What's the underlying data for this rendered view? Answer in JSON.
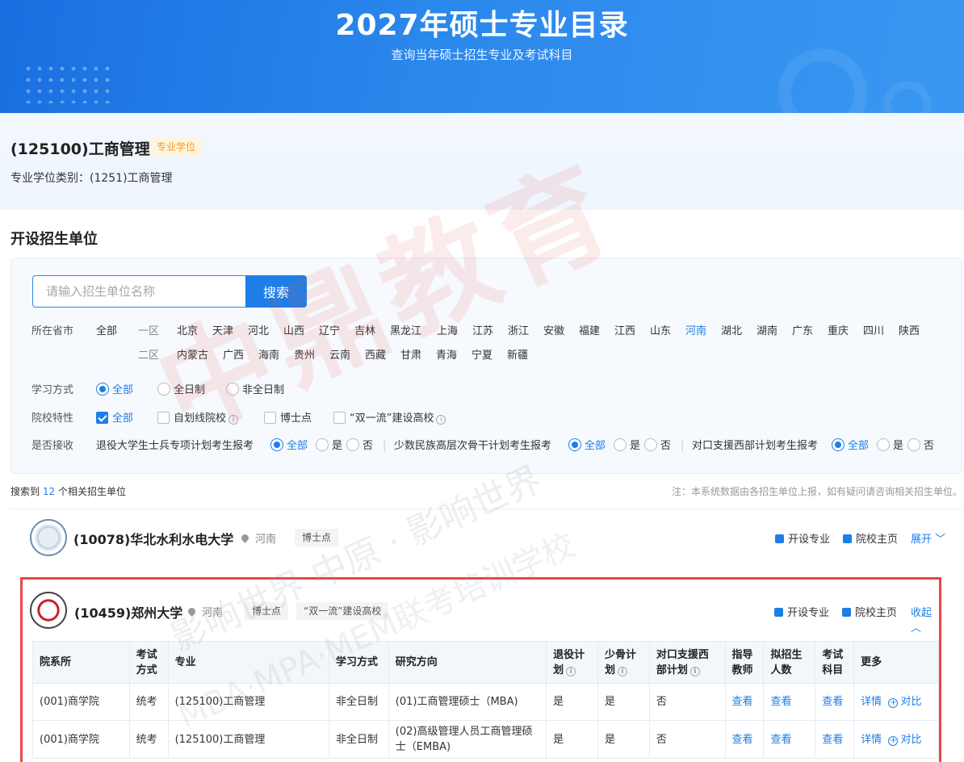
{
  "banner": {
    "title": "2027年硕士专业目录",
    "subtitle": "查询当年硕士招生专业及考试科目"
  },
  "major": {
    "title": "(125100)工商管理",
    "degree_tag": "专业学位",
    "category": "专业学位类别：(1251)工商管理"
  },
  "section_title": "开设招生单位",
  "search": {
    "placeholder": "请输入招生单位名称",
    "button": "搜索"
  },
  "filters": {
    "province_label": "所在省市",
    "all_label": "全部",
    "zone1_label": "一区",
    "zone2_label": "二区",
    "zone1": [
      "北京",
      "天津",
      "河北",
      "山西",
      "辽宁",
      "吉林",
      "黑龙江",
      "上海",
      "江苏",
      "浙江",
      "安徽",
      "福建",
      "江西",
      "山东",
      "河南",
      "湖北",
      "湖南",
      "广东",
      "重庆",
      "四川",
      "陕西"
    ],
    "zone2": [
      "内蒙古",
      "广西",
      "海南",
      "贵州",
      "云南",
      "西藏",
      "甘肃",
      "青海",
      "宁夏",
      "新疆"
    ],
    "selected_province": "河南",
    "study_mode_label": "学习方式",
    "study_modes": [
      "全部",
      "全日制",
      "非全日制"
    ],
    "school_type_label": "院校特性",
    "school_types": [
      "全部",
      "自划线院校",
      "博士点",
      "“双一流”建设高校"
    ],
    "accept_label": "是否接收",
    "accept_groups": [
      {
        "label": "退役大学生士兵专项计划考生报考",
        "options": [
          "全部",
          "是",
          "否"
        ]
      },
      {
        "label": "少数民族高层次骨干计划考生报考",
        "options": [
          "全部",
          "是",
          "否"
        ]
      },
      {
        "label": "对口支援西部计划考生报考",
        "options": [
          "全部",
          "是",
          "否"
        ]
      }
    ]
  },
  "results": {
    "prefix": "搜索到",
    "count": "12",
    "suffix": "个相关招生单位",
    "notice": "注：本系统数据由各招生单位上报，如有疑问请咨询相关招生单位。"
  },
  "schools": [
    {
      "name": "(10078)华北水利水电大学",
      "location": "河南",
      "badges": [
        "博士点"
      ],
      "majors_link": "开设专业",
      "home_link": "院校主页",
      "toggle": "展开"
    },
    {
      "name": "(10459)郑州大学",
      "location": "河南",
      "badges": [
        "博士点",
        "“双一流”建设高校"
      ],
      "majors_link": "开设专业",
      "home_link": "院校主页",
      "toggle": "收起"
    }
  ],
  "table": {
    "headers": [
      "院系所",
      "考试方式",
      "专业",
      "学习方式",
      "研究方向",
      "退役计划",
      "少骨计划",
      "对口支援西部计划",
      "指导教师",
      "拟招生人数",
      "考试科目",
      "更多"
    ],
    "rows": [
      [
        "(001)商学院",
        "统考",
        "(125100)工商管理",
        "非全日制",
        "(01)工商管理硕士（MBA)",
        "是",
        "是",
        "否",
        "查看",
        "查看",
        "查看",
        "详情",
        "对比"
      ],
      [
        "(001)商学院",
        "统考",
        "(125100)工商管理",
        "非全日制",
        "(02)高级管理人员工商管理硕士（EMBA)",
        "是",
        "是",
        "否",
        "查看",
        "查看",
        "查看",
        "详情",
        "对比"
      ]
    ]
  },
  "watermark": {
    "main": "中鼎教育",
    "line2": "影响世界 中原 · 影响世界",
    "line3": "MBA·MPA·MEM联考培训学校"
  }
}
